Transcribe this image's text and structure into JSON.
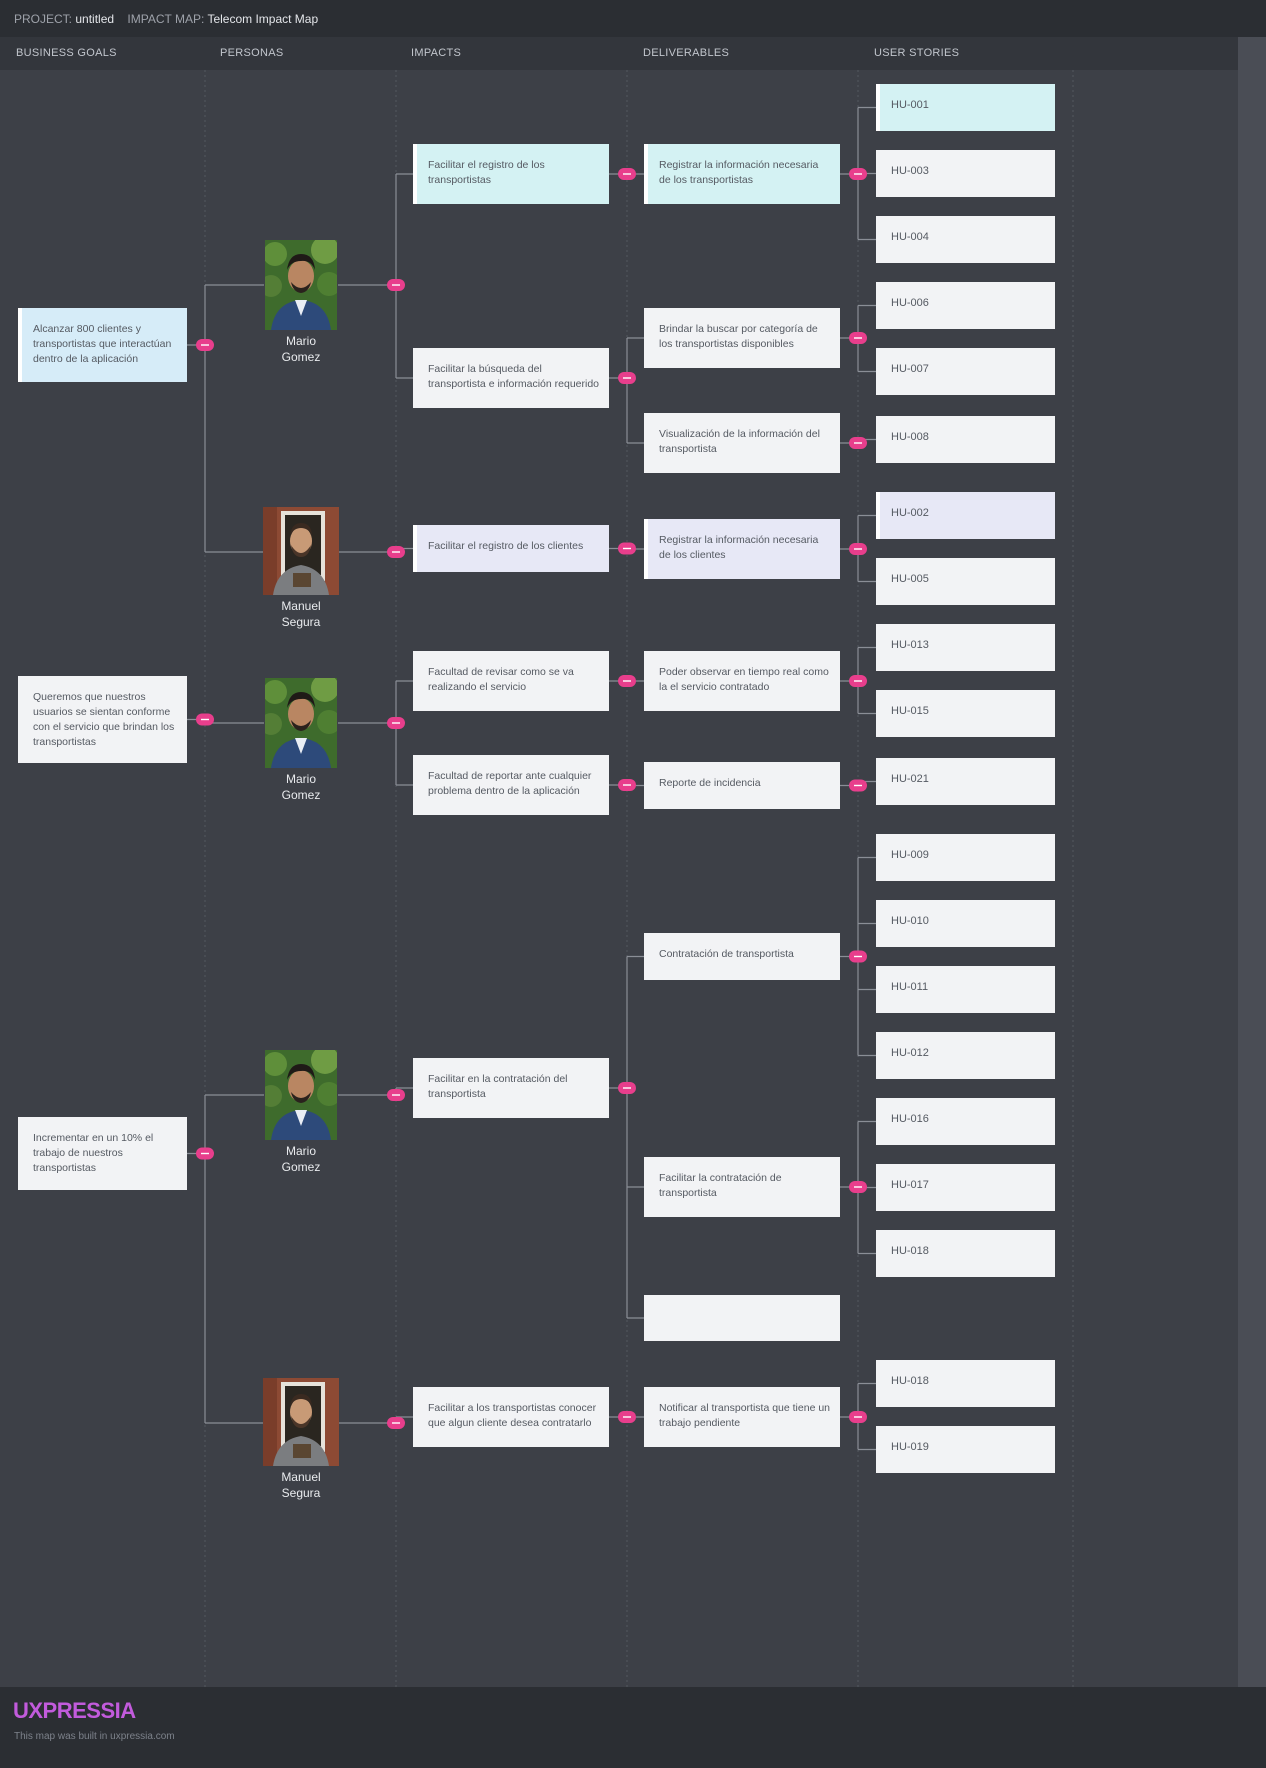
{
  "topbar": {
    "project_label": "PROJECT:",
    "project_name": "untitled",
    "map_label": "IMPACT MAP:",
    "map_name": "Telecom Impact Map"
  },
  "columns": [
    "BUSINESS GOALS",
    "PERSONAS",
    "IMPACTS",
    "DELIVERABLES",
    "USER STORIES"
  ],
  "colors": {
    "background": "#3d4047",
    "card": "#f2f3f5",
    "cyan": "#d4f2f3",
    "blue": "#d6ecf8",
    "lavender": "#e7e8f6",
    "connector": "#e83e8c",
    "line": "#8a8e96"
  },
  "persona_names": {
    "mario": [
      "Mario",
      "Gomez"
    ],
    "manuel": [
      "Manuel",
      "Segura"
    ]
  },
  "goals": [
    {
      "text": "Alcanzar 800 clientes y transportistas  que interactúan dentro de la aplicación",
      "color": "blue",
      "personas": [
        {
          "persona": "mario",
          "impacts": [
            {
              "text": "Facilitar el registro de los transportistas",
              "color": "cyan",
              "deliverables": [
                {
                  "text": "Registrar la información necesaria de los transportistas",
                  "color": "cyan",
                  "stories": [
                    {
                      "text": "HU-001",
                      "color": "cyan"
                    },
                    {
                      "text": "HU-003"
                    },
                    {
                      "text": "HU-004"
                    }
                  ]
                }
              ]
            },
            {
              "text": "Facilitar la búsqueda del transportista e información requerido",
              "deliverables": [
                {
                  "text": "Brindar la  buscar por categoría de los transportistas disponibles",
                  "stories": [
                    {
                      "text": "HU-006"
                    },
                    {
                      "text": "HU-007"
                    }
                  ]
                },
                {
                  "text": "Visualización de la información del transportista",
                  "stories": [
                    {
                      "text": "HU-008"
                    }
                  ]
                }
              ]
            }
          ]
        },
        {
          "persona": "manuel",
          "impacts": [
            {
              "text": "Facilitar el registro de los clientes",
              "color": "lav",
              "deliverables": [
                {
                  "text": "Registrar la información necesaria de los clientes",
                  "color": "lav",
                  "stories": [
                    {
                      "text": "HU-002",
                      "color": "lav"
                    },
                    {
                      "text": "HU-005"
                    }
                  ]
                }
              ]
            }
          ]
        }
      ]
    },
    {
      "text": "Queremos que nuestros usuarios se sientan conforme con el servicio que brindan los transportistas",
      "personas": [
        {
          "persona": "mario",
          "impacts": [
            {
              "text": "Facultad de revisar como se va realizando el servicio",
              "deliverables": [
                {
                  "text": "Poder observar en tiempo real como la el servicio contratado",
                  "stories": [
                    {
                      "text": "HU-013"
                    },
                    {
                      "text": "HU-015"
                    }
                  ]
                }
              ]
            },
            {
              "text": "Facultad de reportar ante cualquier problema dentro de la aplicación",
              "deliverables": [
                {
                  "text": "Reporte de incidencia",
                  "stories": [
                    {
                      "text": "HU-021"
                    }
                  ]
                }
              ]
            }
          ]
        }
      ]
    },
    {
      "text": "Incrementar en un 10% el trabajo de nuestros transportistas",
      "personas": [
        {
          "persona": "mario",
          "impacts": [
            {
              "text": "Facilitar en la contratación del transportista",
              "deliverables": [
                {
                  "text": "Contratación de transportista",
                  "stories": [
                    {
                      "text": "HU-009"
                    },
                    {
                      "text": "HU-010"
                    },
                    {
                      "text": "HU-011"
                    },
                    {
                      "text": "HU-012"
                    }
                  ]
                },
                {
                  "text": "Facilitar la contratación de transportista",
                  "stories": [
                    {
                      "text": "HU-016"
                    },
                    {
                      "text": "HU-017"
                    },
                    {
                      "text": "HU-018"
                    }
                  ]
                },
                {
                  "text": "",
                  "stories": []
                }
              ]
            }
          ]
        },
        {
          "persona": "manuel",
          "impacts": [
            {
              "text": "Facilitar a los transportistas conocer que algun cliente desea contratarlo",
              "deliverables": [
                {
                  "text": "Notificar al transportista que tiene un trabajo pendiente",
                  "stories": [
                    {
                      "text": "HU-018"
                    },
                    {
                      "text": "HU-019"
                    }
                  ]
                }
              ]
            }
          ]
        }
      ]
    }
  ],
  "footer": {
    "logo": "UXPRESSIA",
    "credit": "This map was built in uxpressia.com"
  }
}
